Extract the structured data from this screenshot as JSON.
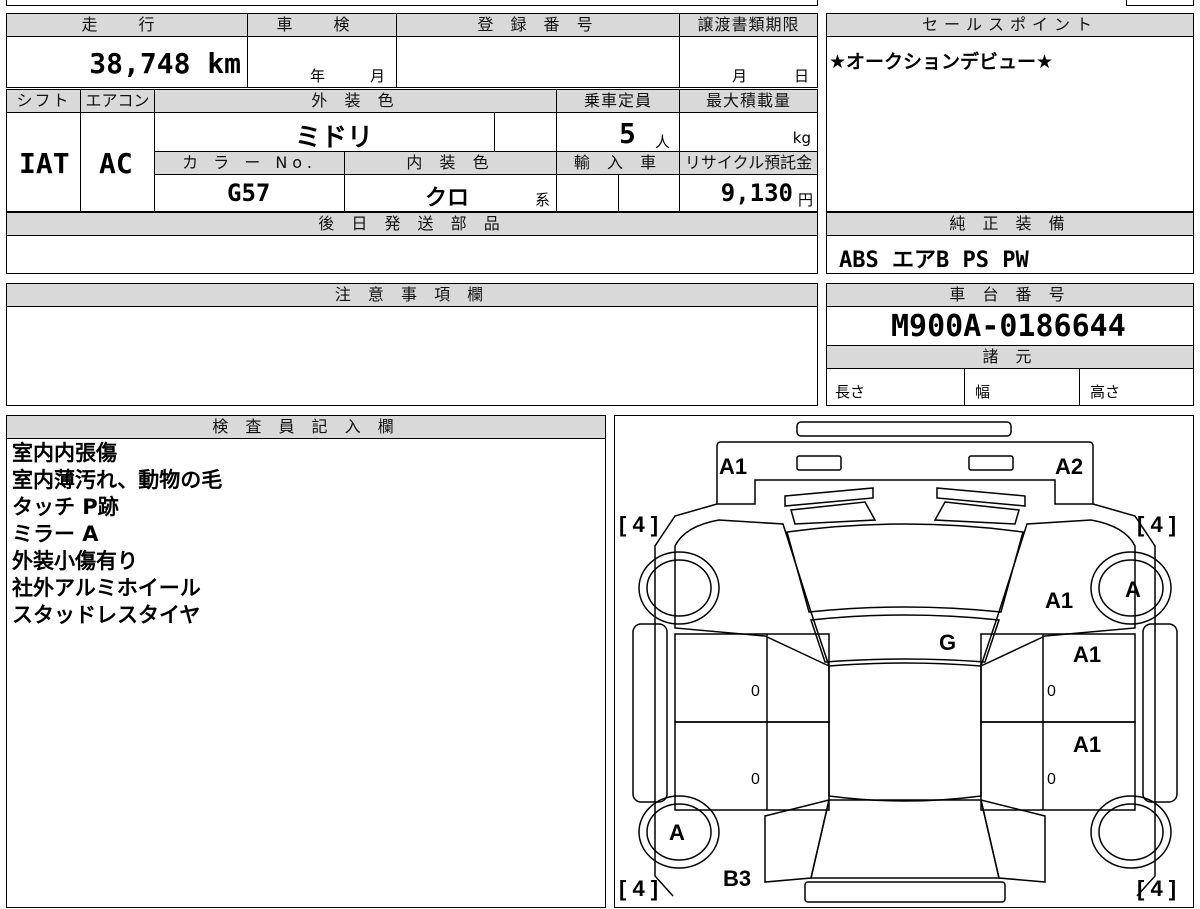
{
  "vehicle": {
    "mileage_label": "走 行",
    "mileage_value": "38,748 km",
    "inspection_label": "車 検",
    "inspection_year_unit": "年",
    "inspection_month_unit": "月",
    "reg_number_label": "登 録 番 号",
    "transfer_deadline_label": "譲渡書類期限",
    "transfer_month_unit": "月",
    "transfer_day_unit": "日",
    "shift_label": "シフト",
    "shift_value": "IAT",
    "aircon_label": "エアコン",
    "aircon_value": "AC",
    "exterior_color_label": "外 装 色",
    "exterior_color_value": "ミドリ",
    "capacity_label": "乗車定員",
    "capacity_value": "5",
    "capacity_unit": "人",
    "max_load_label": "最大積載量",
    "max_load_unit": "kg",
    "color_no_label": "カ ラ ー No.",
    "color_no_value": "G57",
    "interior_color_label": "内 装 色",
    "interior_color_value": "クロ",
    "interior_color_suffix": "系",
    "import_label": "輸 入 車",
    "recycle_label": "リサイクル預託金",
    "recycle_value": "9,130",
    "recycle_unit": "円",
    "later_parts_label": "後 日 発 送 部 品"
  },
  "sales_point": {
    "label": "セールスポイント",
    "text": "★オークションデビュー★"
  },
  "genuine_equipment": {
    "label": "純 正 装 備",
    "text": "ABS エアB PS PW"
  },
  "notes": {
    "label": "注 意 事 項 欄"
  },
  "chassis": {
    "label": "車 台 番 号",
    "value": "M900A-0186644",
    "spec_label": "諸 元",
    "length_label": "長さ",
    "width_label": "幅",
    "height_label": "高さ"
  },
  "inspector": {
    "label": "検 査 員 記 入 欄",
    "lines": [
      "室内内張傷",
      "室内薄汚れ、動物の毛",
      "タッチ P跡",
      "ミラー A",
      "外装小傷有り",
      "社外アルミホイール",
      "スタッドレスタイヤ"
    ]
  },
  "diagram": {
    "marks": {
      "front_left": "A1",
      "front_right": "A2",
      "right_fender": "A1",
      "right_front_door": "A1",
      "right_rear_door": "A1",
      "roof": "G",
      "wheel_front_right": "A",
      "wheel_rear_left": "A",
      "rear_left": "B3"
    },
    "tire_fl": "[ 4 ]",
    "tire_fr": "[ 4 ]",
    "tire_rl": "[ 4 ]",
    "tire_rr": "[ 4 ]",
    "door_zero": "0"
  }
}
